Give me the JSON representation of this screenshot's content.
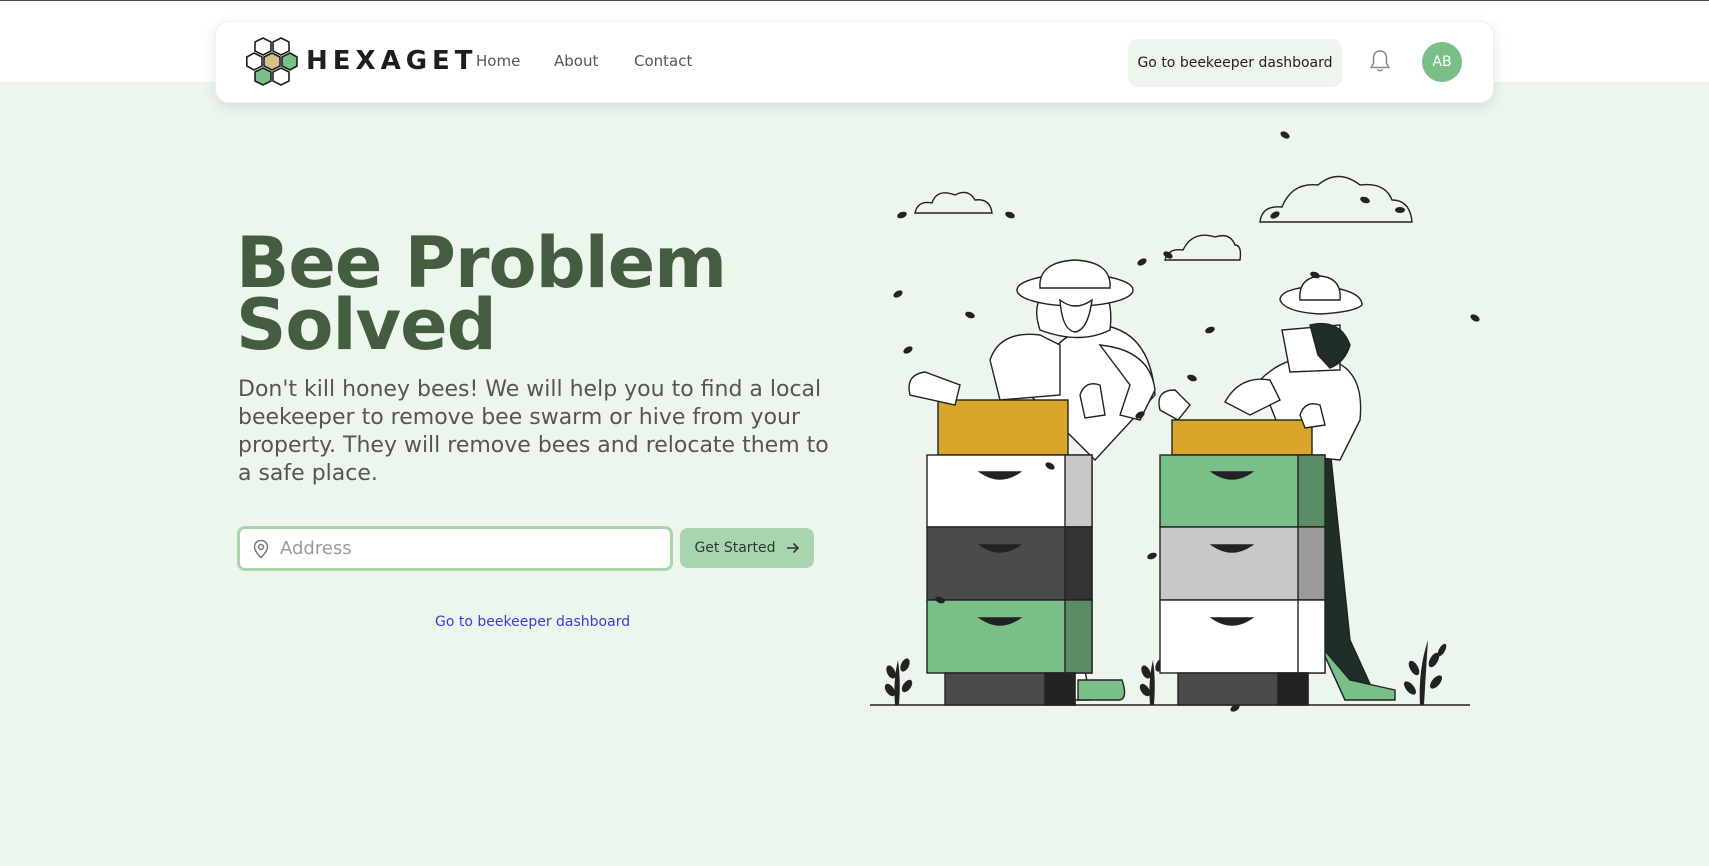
{
  "navbar": {
    "logo_text": "HEXAGET",
    "links": [
      "Home",
      "About",
      "Contact"
    ],
    "dashboard_button": "Go to beekeeper dashboard",
    "avatar_initials": "AB"
  },
  "hero": {
    "title_line1": "Bee Problem",
    "title_line2": "Solved",
    "description": "Don't kill honey bees! We will help you to find a local beekeeper to remove bee swarm or hive from your property. They will remove bees and relocate them to a safe place.",
    "address_placeholder": "Address",
    "get_started_label": "Get Started",
    "dashboard_link": "Go to beekeeper dashboard"
  },
  "colors": {
    "accent_green": "#a9d4ae",
    "title_green": "#445c40",
    "background": "#ecf6ec",
    "link_blue": "#3b3bdc"
  }
}
